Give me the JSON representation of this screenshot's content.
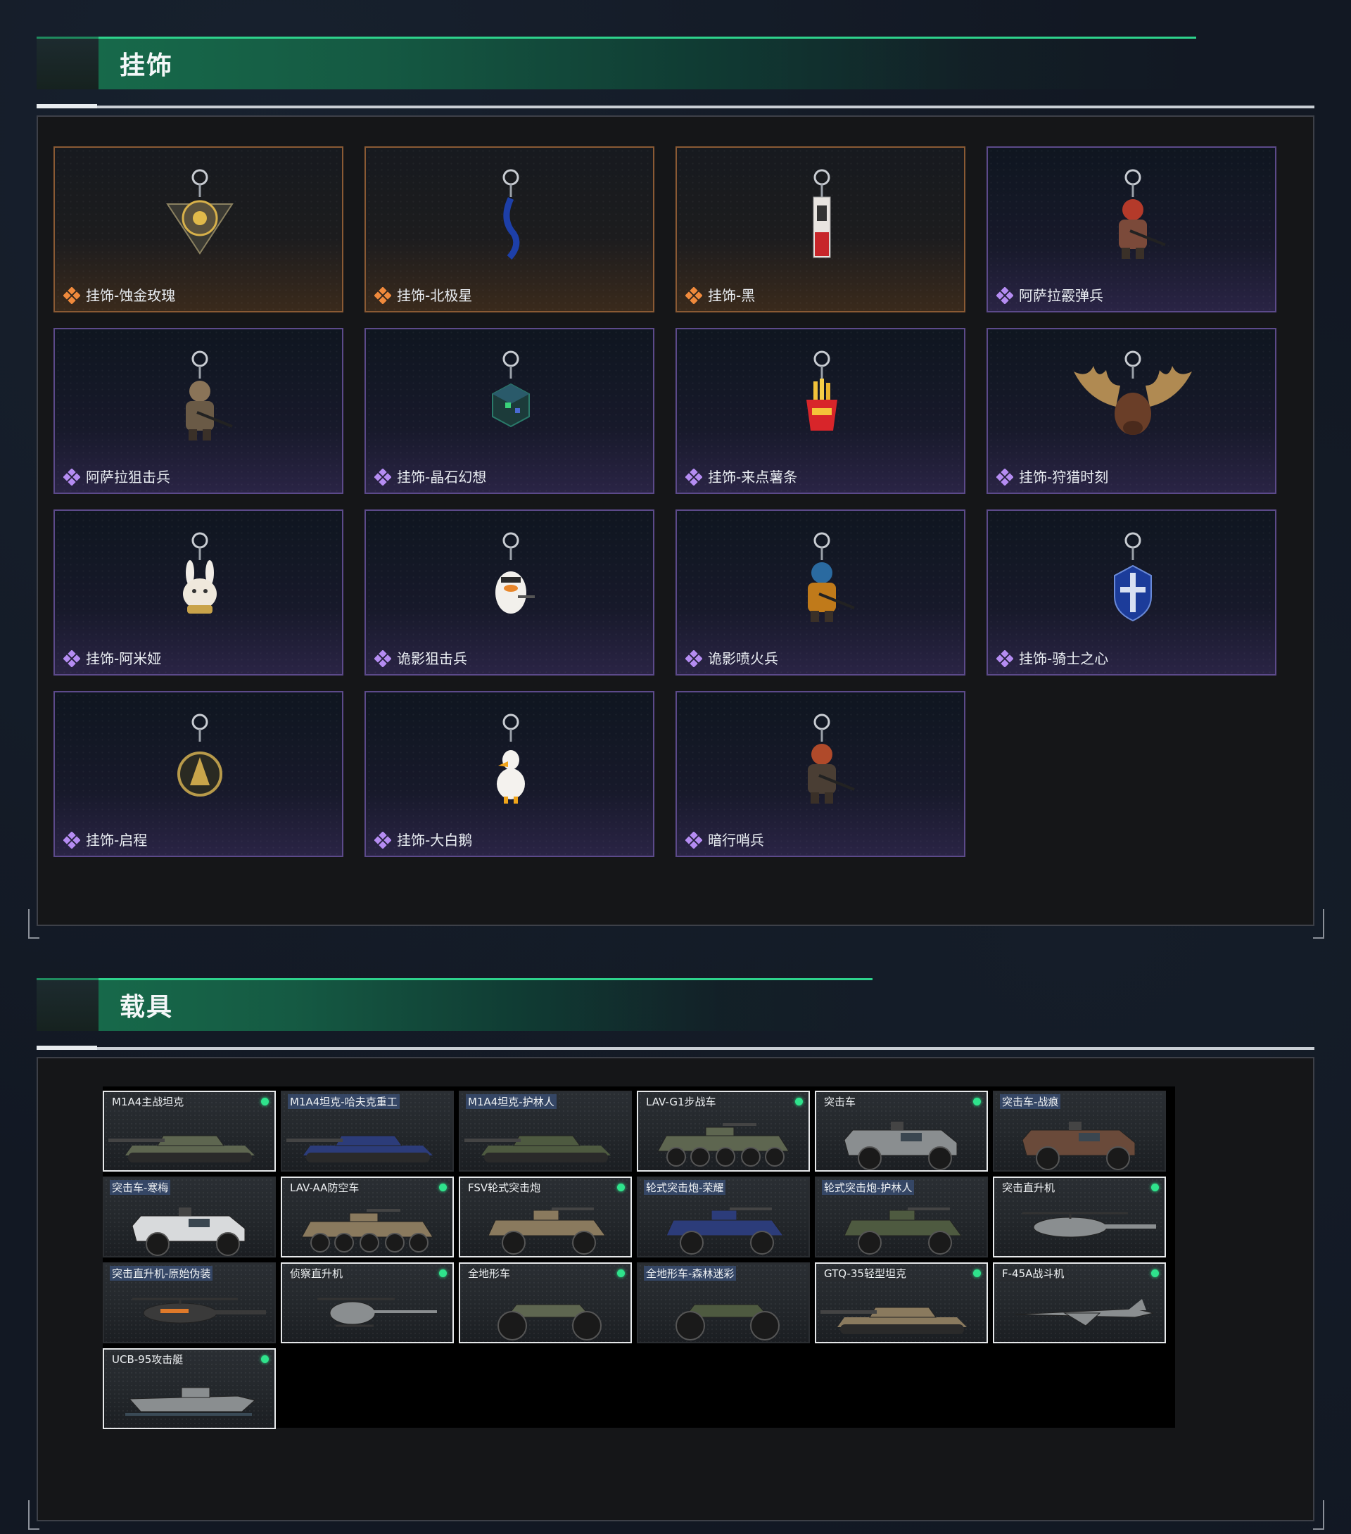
{
  "colors": {
    "accent_green": "#2ed28c",
    "owned_dot": "#2fe38c",
    "legendary_border": "#8a5a34",
    "epic_border": "#5c4a8a",
    "epic_icon": "#b58cf2",
    "legendary_icon": "#f08a3c"
  },
  "charms_section": {
    "title": "挂饰",
    "items": [
      {
        "name": "挂饰-蚀金玫瑰",
        "rarity": "legendary",
        "icon": "gold-rose-compass-charm-icon"
      },
      {
        "name": "挂饰-北极星",
        "rarity": "legendary",
        "icon": "blue-ribbon-charm-icon"
      },
      {
        "name": "挂饰-黑",
        "rarity": "legendary",
        "icon": "tag-card-charm-icon"
      },
      {
        "name": "阿萨拉霰弹兵",
        "rarity": "epic",
        "icon": "shotgunner-figure-charm-icon"
      },
      {
        "name": "阿萨拉狙击兵",
        "rarity": "epic",
        "icon": "sniper-figure-charm-icon"
      },
      {
        "name": "挂饰-晶石幻想",
        "rarity": "epic",
        "icon": "crystal-cube-charm-icon"
      },
      {
        "name": "挂饰-来点薯条",
        "rarity": "epic",
        "icon": "fries-charm-icon"
      },
      {
        "name": "挂饰-狩猎时刻",
        "rarity": "epic",
        "icon": "moose-antlers-charm-icon"
      },
      {
        "name": "挂饰-阿米娅",
        "rarity": "epic",
        "icon": "bunny-charm-icon"
      },
      {
        "name": "诡影狙击兵",
        "rarity": "epic",
        "icon": "duck-sniper-charm-icon"
      },
      {
        "name": "诡影喷火兵",
        "rarity": "epic",
        "icon": "flamethrower-figure-charm-icon"
      },
      {
        "name": "挂饰-骑士之心",
        "rarity": "epic",
        "icon": "knight-heart-charm-icon"
      },
      {
        "name": "挂饰-启程",
        "rarity": "epic",
        "icon": "departure-medal-charm-icon"
      },
      {
        "name": "挂饰-大白鹅",
        "rarity": "epic",
        "icon": "white-goose-charm-icon"
      },
      {
        "name": "暗行哨兵",
        "rarity": "epic",
        "icon": "sentinel-figure-charm-icon"
      }
    ]
  },
  "vehicles_section": {
    "title": "载具",
    "items": [
      {
        "name": "M1A4主战坦克",
        "owned": true,
        "type": "tank",
        "camo": "green"
      },
      {
        "name": "M1A4坦克-哈夫克重工",
        "owned": false,
        "type": "tank",
        "camo": "blue"
      },
      {
        "name": "M1A4坦克-护林人",
        "owned": false,
        "type": "tank",
        "camo": "forest"
      },
      {
        "name": "LAV-G1步战车",
        "owned": true,
        "type": "apc8",
        "camo": "green"
      },
      {
        "name": "突击车",
        "owned": true,
        "type": "truck",
        "camo": "grey"
      },
      {
        "name": "突击车-战痕",
        "owned": false,
        "type": "truck",
        "camo": "rust"
      },
      {
        "name": "突击车-寒梅",
        "owned": false,
        "type": "truck",
        "camo": "white"
      },
      {
        "name": "LAV-AA防空车",
        "owned": true,
        "type": "apc8",
        "camo": "sand"
      },
      {
        "name": "FSV轮式突击炮",
        "owned": true,
        "type": "buggy",
        "camo": "sand"
      },
      {
        "name": "轮式突击炮-荣耀",
        "owned": false,
        "type": "buggy",
        "camo": "blue"
      },
      {
        "name": "轮式突击炮-护林人",
        "owned": false,
        "type": "buggy",
        "camo": "forest"
      },
      {
        "name": "突击直升机",
        "owned": true,
        "type": "heli",
        "camo": "grey"
      },
      {
        "name": "突击直升机-原始伪装",
        "owned": false,
        "type": "heli",
        "camo": "orange"
      },
      {
        "name": "侦察直升机",
        "owned": true,
        "type": "scout",
        "camo": "grey"
      },
      {
        "name": "全地形车",
        "owned": true,
        "type": "atv",
        "camo": "green"
      },
      {
        "name": "全地形车-森林迷彩",
        "owned": false,
        "type": "atv",
        "camo": "forest"
      },
      {
        "name": "GTQ-35轻型坦克",
        "owned": true,
        "type": "tank",
        "camo": "sand"
      },
      {
        "name": "F-45A战斗机",
        "owned": true,
        "type": "jet",
        "camo": "grey"
      },
      {
        "name": "UCB-95攻击艇",
        "owned": true,
        "type": "boat",
        "camo": "grey"
      }
    ]
  }
}
